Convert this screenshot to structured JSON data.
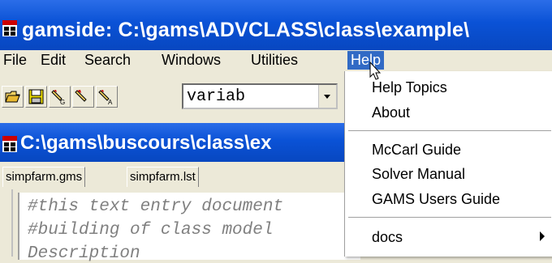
{
  "window": {
    "title": "gamside: C:\\gams\\ADVCLASS\\class\\example\\",
    "app_icon": "ide-icon"
  },
  "menubar": {
    "items": [
      "File",
      "Edit",
      "Search",
      "Windows",
      "Utilities",
      "Help"
    ],
    "active": "Help"
  },
  "toolbar": {
    "buttons": [
      "open-folder-icon",
      "save-disk-icon",
      "model-tool-icon",
      "marker-tool-icon",
      "marker-a-icon"
    ],
    "search_value": "variab"
  },
  "child_window": {
    "title": "C:\\gams\\buscours\\class\\ex",
    "tabs": [
      "simpfarm.gms",
      "simpfarm.lst"
    ],
    "editor_lines": [
      "#this text entry document",
      "#building of class model",
      "Description"
    ]
  },
  "help_menu": {
    "items": [
      "Help Topics",
      "About",
      "McCarl Guide",
      "Solver Manual",
      "GAMS Users Guide",
      "docs"
    ]
  }
}
